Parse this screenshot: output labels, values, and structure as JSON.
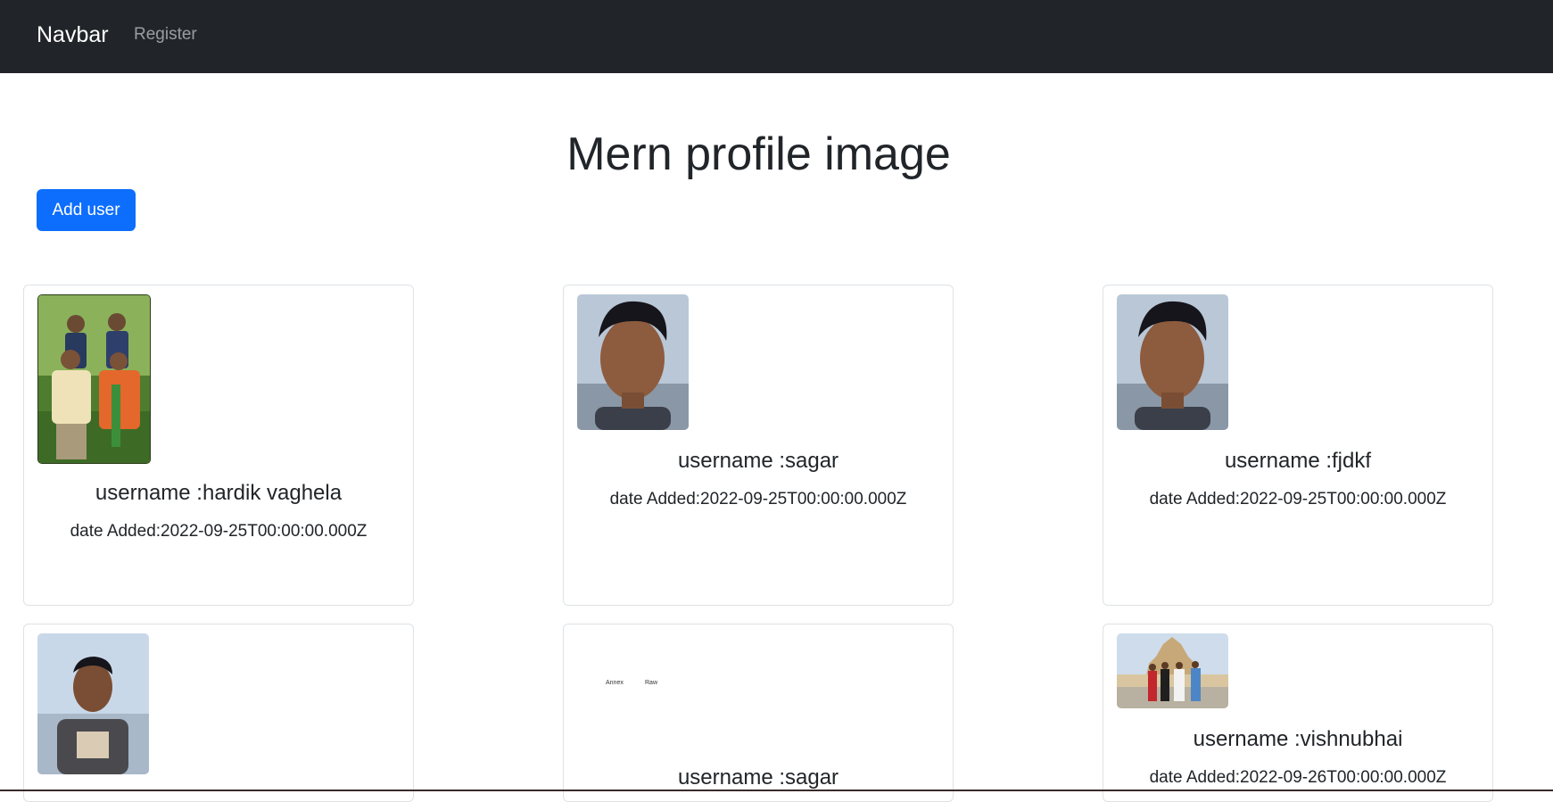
{
  "navbar": {
    "brand": "Navbar",
    "links": [
      "Register"
    ]
  },
  "page": {
    "title": "Mern profile image",
    "add_button": "Add user"
  },
  "cards": [
    {
      "username": "username :hardik vaghela",
      "date": "date Added:2022-09-25T00:00:00.000Z",
      "photo": "family-photo"
    },
    {
      "username": "username :sagar",
      "date": "date Added:2022-09-25T00:00:00.000Z",
      "photo": "portrait-photo"
    },
    {
      "username": "username :fjdkf",
      "date": "date Added:2022-09-25T00:00:00.000Z",
      "photo": "portrait-photo"
    },
    {
      "username": "",
      "date": "",
      "photo": "portrait-tshirt-photo"
    },
    {
      "username": "username :sagar",
      "date": "",
      "photo": "document-photo",
      "photo_text": [
        "Annex",
        "Raw"
      ]
    },
    {
      "username": "username :vishnubhai",
      "date": "date Added:2022-09-26T00:00:00.000Z",
      "photo": "temple-group-photo"
    }
  ],
  "colors": {
    "navbar_bg": "#212529",
    "primary": "#0d6efd",
    "card_border": "#dee2e6"
  }
}
